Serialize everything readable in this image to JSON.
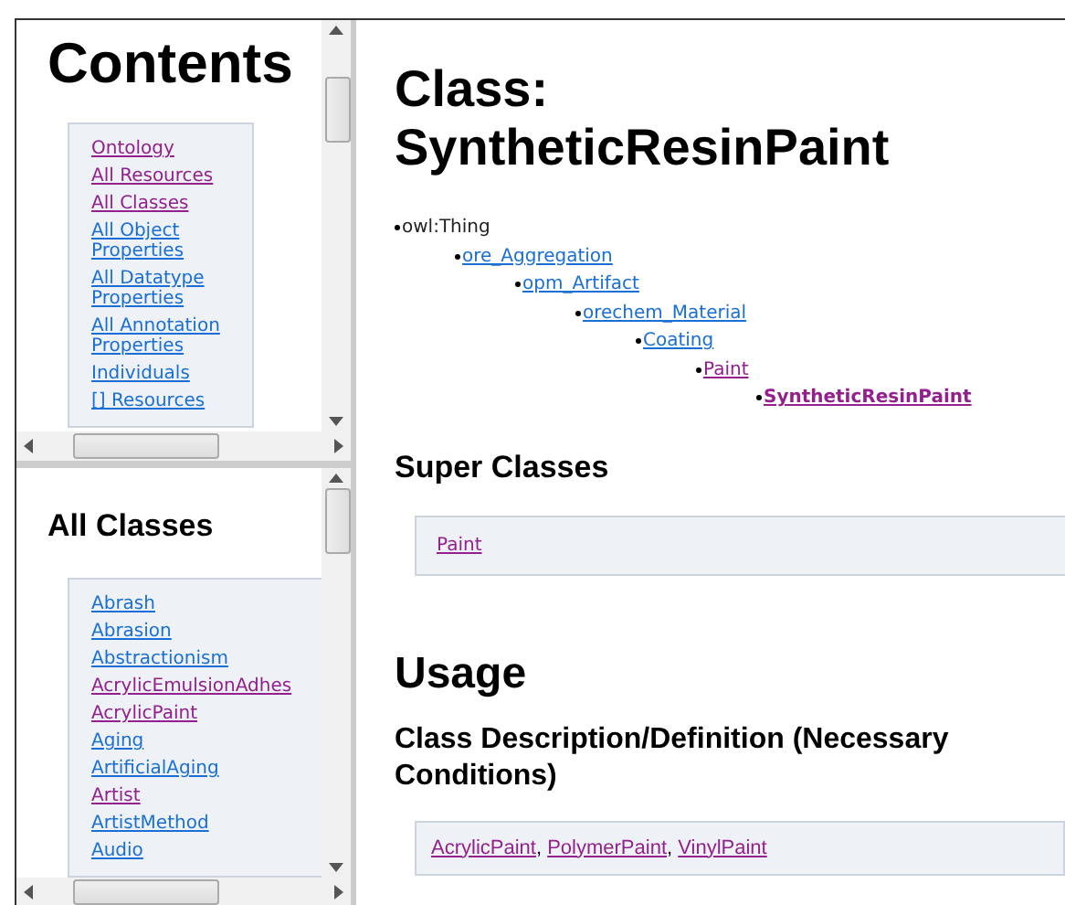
{
  "contents_pane": {
    "heading": "Contents",
    "links": [
      {
        "label": "Ontology",
        "visited": true
      },
      {
        "label": "All Resources",
        "visited": true
      },
      {
        "label": "All Classes",
        "visited": true
      },
      {
        "label": "All Object Properties",
        "visited": false
      },
      {
        "label": "All Datatype Properties",
        "visited": false
      },
      {
        "label": "All Annotation Properties",
        "visited": false
      },
      {
        "label": "Individuals",
        "visited": false
      },
      {
        "label": "[] Resources",
        "visited": false
      }
    ]
  },
  "classes_pane": {
    "heading": "All Classes",
    "links": [
      {
        "label": "Abrash",
        "visited": false
      },
      {
        "label": "Abrasion",
        "visited": false
      },
      {
        "label": "Abstractionism",
        "visited": false
      },
      {
        "label": "AcrylicEmulsionAdhes",
        "visited": true
      },
      {
        "label": "AcrylicPaint",
        "visited": true
      },
      {
        "label": "Aging",
        "visited": false
      },
      {
        "label": "ArtificialAging",
        "visited": false
      },
      {
        "label": "Artist",
        "visited": true
      },
      {
        "label": "ArtistMethod",
        "visited": false
      },
      {
        "label": "Audio",
        "visited": false
      }
    ]
  },
  "main": {
    "title": "Class: SyntheticResinPaint",
    "hierarchy": [
      {
        "label": "owl:Thing",
        "kind": "plain",
        "children": [
          {
            "label": "ore_Aggregation",
            "kind": "link",
            "visited": false,
            "children": [
              {
                "label": "opm_Artifact",
                "kind": "link",
                "visited": false,
                "children": [
                  {
                    "label": "orechem_Material",
                    "kind": "link",
                    "visited": false,
                    "children": [
                      {
                        "label": "Coating",
                        "kind": "link",
                        "visited": false,
                        "children": [
                          {
                            "label": "Paint",
                            "kind": "link",
                            "visited": true,
                            "children": [
                              {
                                "label": "SyntheticResinPaint",
                                "kind": "current",
                                "visited": true
                              }
                            ]
                          }
                        ]
                      }
                    ]
                  }
                ]
              }
            ]
          }
        ]
      }
    ],
    "super_classes": {
      "heading": "Super Classes",
      "links": [
        {
          "label": "Paint",
          "visited": true
        }
      ]
    },
    "usage": {
      "heading": "Usage"
    },
    "description": {
      "heading": "Class Description/Definition (Necessary Conditions)",
      "separator": ",",
      "links": [
        {
          "label": "AcrylicPaint",
          "visited": true
        },
        {
          "label": "PolymerPaint",
          "visited": true
        },
        {
          "label": "VinylPaint",
          "visited": true
        }
      ]
    }
  }
}
